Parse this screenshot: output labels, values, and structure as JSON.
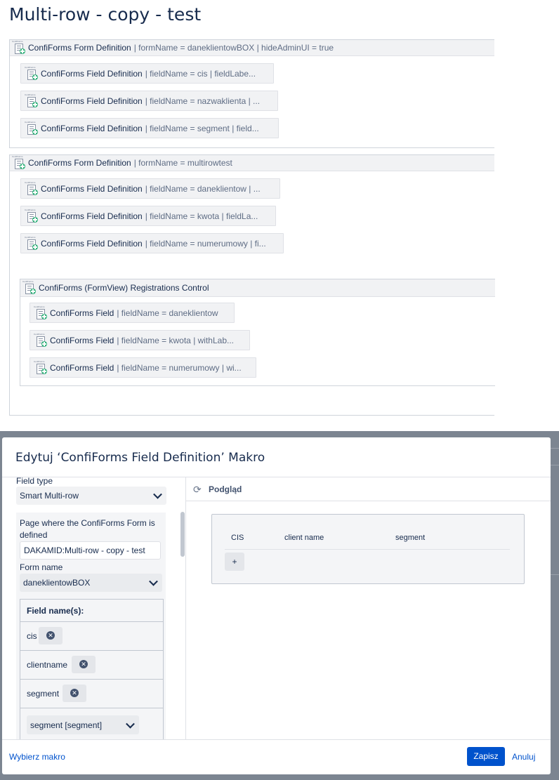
{
  "page": {
    "title": "Multi-row - copy - test"
  },
  "icon_tiny_text": "ConfiForms",
  "forms": [
    {
      "name": "ConfiForms Form Definition",
      "params": "| formName = daneklientowBOX | hideAdminUI = true",
      "fields": [
        {
          "name": "ConfiForms Field Definition",
          "params": "| fieldName = cis | fieldLabe..."
        },
        {
          "name": "ConfiForms Field Definition",
          "params": "| fieldName = nazwaklienta | ..."
        },
        {
          "name": "ConfiForms Field Definition",
          "params": "| fieldName = segment | field..."
        }
      ]
    },
    {
      "name": "ConfiForms Form Definition",
      "params": "| formName = multirowtest",
      "fields": [
        {
          "name": "ConfiForms Field Definition",
          "params": "| fieldName = daneklientow | ..."
        },
        {
          "name": "ConfiForms Field Definition",
          "params": "| fieldName = kwota | fieldLa..."
        },
        {
          "name": "ConfiForms Field Definition",
          "params": "| fieldName = numerumowy | fi..."
        }
      ],
      "registrations": {
        "name": "ConfiForms (FormView) Registrations Control",
        "fields": [
          {
            "name": "ConfiForms Field",
            "params": "| fieldName = daneklientow"
          },
          {
            "name": "ConfiForms Field",
            "params": "| fieldName = kwota | withLab..."
          },
          {
            "name": "ConfiForms Field",
            "params": "| fieldName = numerumowy | wi..."
          }
        ]
      }
    }
  ],
  "dialog": {
    "title": "Edytuj ‘ConfiForms Field Definition’ Makro",
    "field_type_label": "Field type",
    "field_type_value": "Smart Multi-row",
    "page_label": "Page where the ConfiForms Form is defined",
    "page_value": "DAKAMID:Multi-row - copy - test",
    "form_name_label": "Form name",
    "form_name_value": "daneklientowBOX",
    "field_names_header": "Field name(s):",
    "field_names": [
      "cis",
      "clientname",
      "segment"
    ],
    "field_select_value": "segment [segment]",
    "remove_glyph": "✕",
    "preview_label": "Podgląd",
    "preview_columns": [
      "CIS",
      "client name",
      "segment"
    ],
    "add_row_label": "+",
    "footer": {
      "select_macro": "Wybierz makro",
      "save": "Zapisz",
      "cancel": "Anuluj"
    }
  },
  "colors": {
    "primary": "#0052cc",
    "text": "#172b4d",
    "muted": "#5e6c84",
    "backdrop": "#7c8591"
  }
}
